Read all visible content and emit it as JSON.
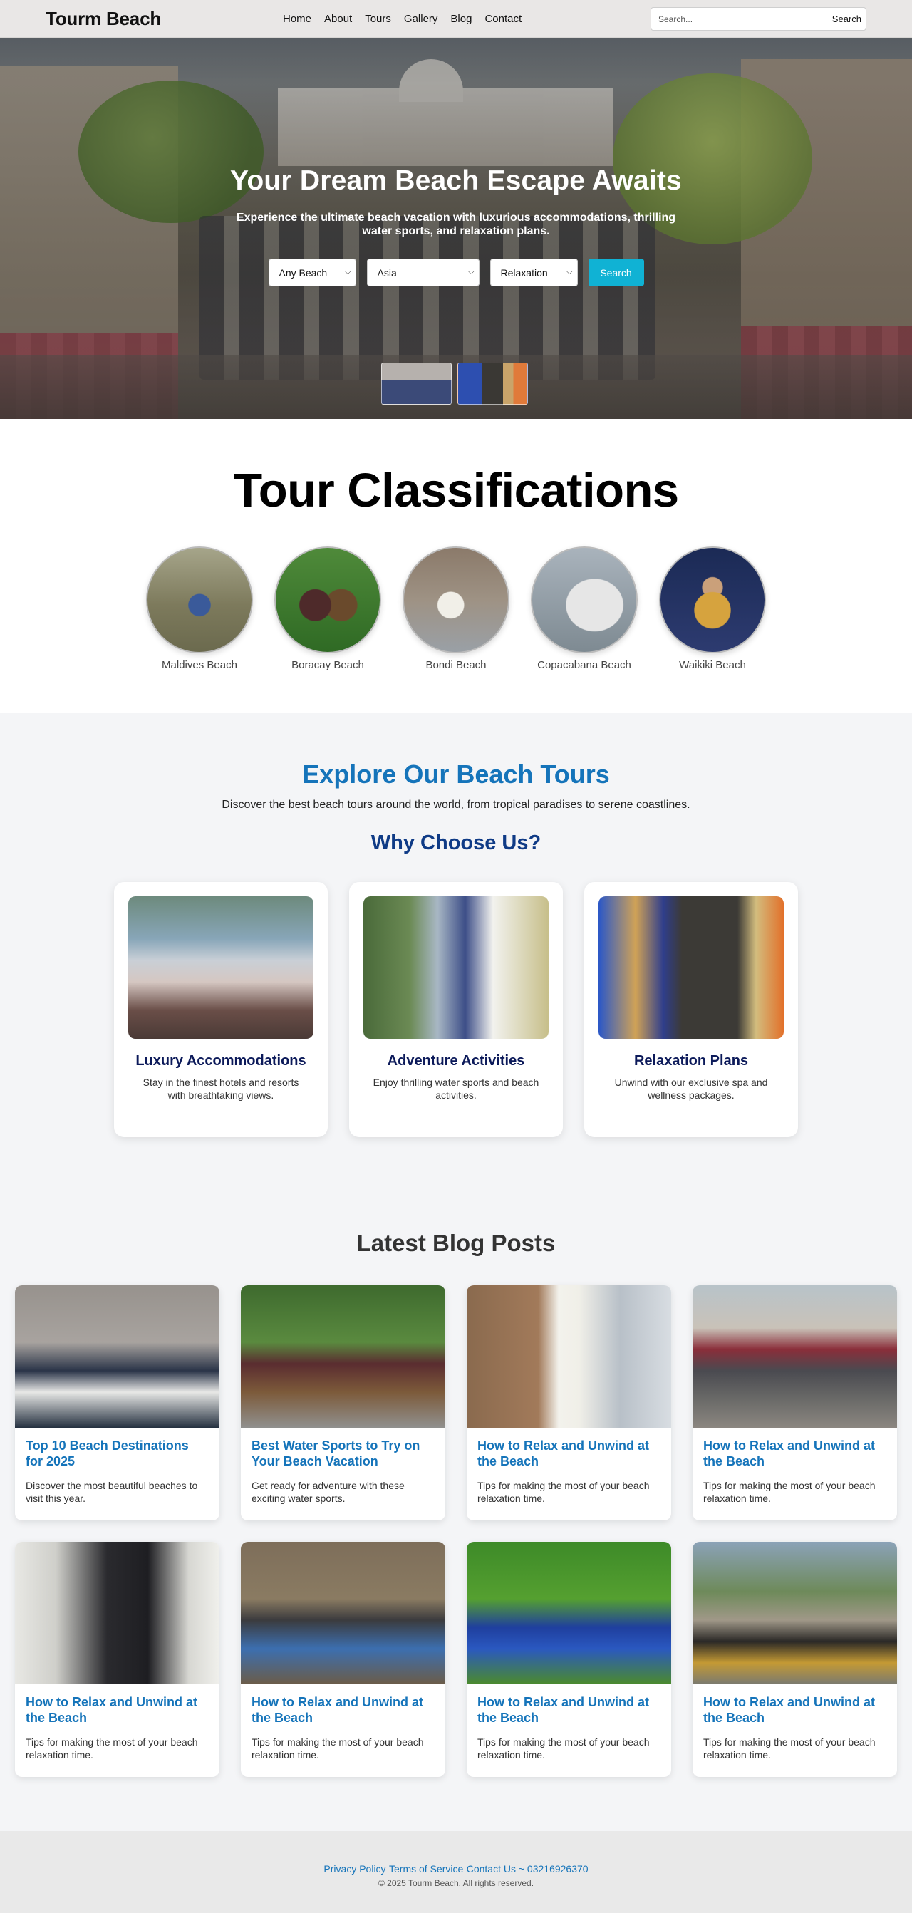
{
  "navbar": {
    "brand": "Tourm Beach",
    "links": [
      "Home",
      "About",
      "Tours",
      "Gallery",
      "Blog",
      "Contact"
    ],
    "search_placeholder": "Search...",
    "search_button": "Search"
  },
  "hero": {
    "title": "Your Dream Beach Escape Awaits",
    "subtitle": "Experience the ultimate beach vacation with luxurious accommodations, thrilling water sports, and relaxation plans.",
    "filters": {
      "beach": "Any Beach",
      "region": "Asia",
      "type": "Relaxation",
      "search_button": "Search"
    }
  },
  "classifications": {
    "title": "Tour Classifications",
    "items": [
      "Maldives Beach",
      "Boracay Beach",
      "Bondi Beach",
      "Copacabana Beach",
      "Waikiki Beach"
    ]
  },
  "explore": {
    "title": "Explore Our Beach Tours",
    "subtitle": "Discover the best beach tours around the world, from tropical paradises to serene coastlines.",
    "why_title": "Why Choose Us?",
    "features": [
      {
        "title": "Luxury Accommodations",
        "desc": "Stay in the finest hotels and resorts with breathtaking views."
      },
      {
        "title": "Adventure Activities",
        "desc": "Enjoy thrilling water sports and beach activities."
      },
      {
        "title": "Relaxation Plans",
        "desc": "Unwind with our exclusive spa and wellness packages."
      }
    ]
  },
  "blog": {
    "title": "Latest Blog Posts",
    "posts": [
      {
        "title": "Top 10 Beach Destinations for 2025",
        "desc": "Discover the most beautiful beaches to visit this year."
      },
      {
        "title": "Best Water Sports to Try on Your Beach Vacation",
        "desc": "Get ready for adventure with these exciting water sports."
      },
      {
        "title": "How to Relax and Unwind at the Beach",
        "desc": "Tips for making the most of your beach relaxation time."
      },
      {
        "title": "How to Relax and Unwind at the Beach",
        "desc": "Tips for making the most of your beach relaxation time."
      },
      {
        "title": "How to Relax and Unwind at the Beach",
        "desc": "Tips for making the most of your beach relaxation time."
      },
      {
        "title": "How to Relax and Unwind at the Beach",
        "desc": "Tips for making the most of your beach relaxation time."
      },
      {
        "title": "How to Relax and Unwind at the Beach",
        "desc": "Tips for making the most of your beach relaxation time."
      },
      {
        "title": "How to Relax and Unwind at the Beach",
        "desc": "Tips for making the most of your beach relaxation time."
      }
    ]
  },
  "footer": {
    "privacy": "Privacy Policy",
    "terms": "Terms of Service",
    "contact": "Contact Us ~ 03216926370",
    "copyright": "© 2025 Tourm Beach. All rights reserved."
  },
  "colors": {
    "accent": "#1574ba",
    "search_button": "#10b2d4",
    "heading_navy": "#0f3b86"
  }
}
